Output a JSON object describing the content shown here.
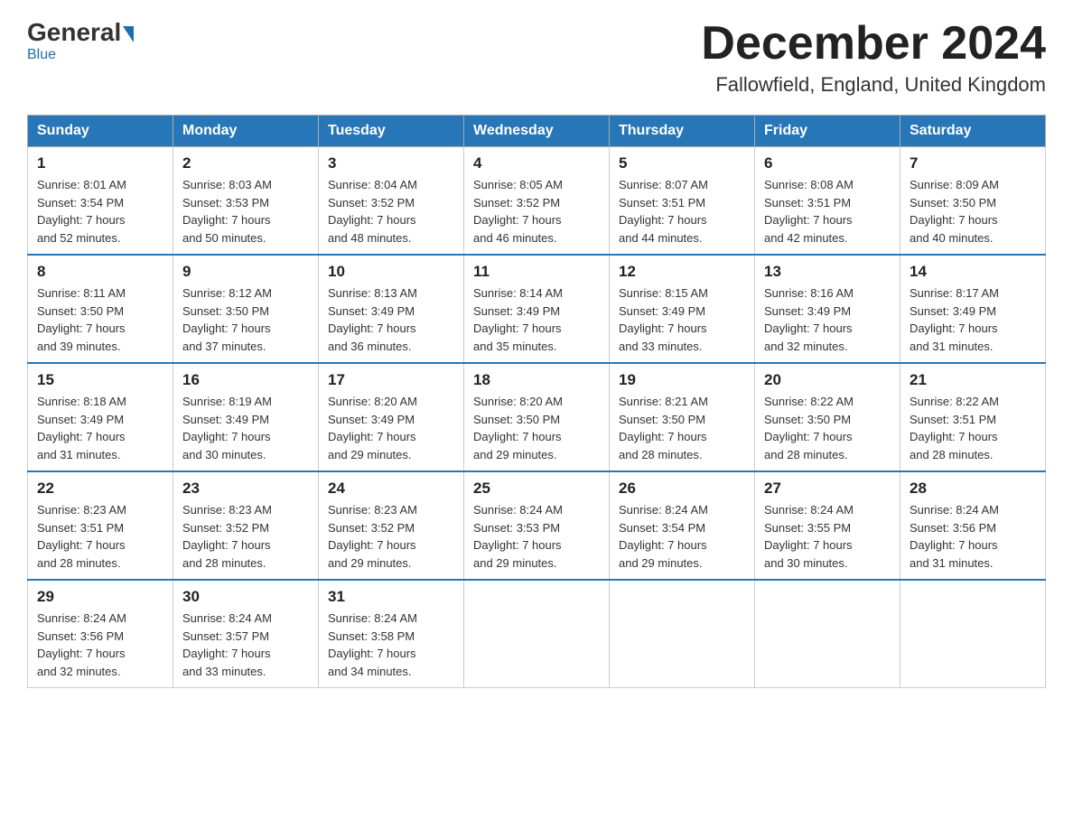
{
  "header": {
    "logo_general": "General",
    "logo_blue": "Blue",
    "month_title": "December 2024",
    "location": "Fallowfield, England, United Kingdom"
  },
  "days_of_week": [
    "Sunday",
    "Monday",
    "Tuesday",
    "Wednesday",
    "Thursday",
    "Friday",
    "Saturday"
  ],
  "weeks": [
    [
      {
        "day": "1",
        "sunrise": "8:01 AM",
        "sunset": "3:54 PM",
        "daylight": "7 hours and 52 minutes."
      },
      {
        "day": "2",
        "sunrise": "8:03 AM",
        "sunset": "3:53 PM",
        "daylight": "7 hours and 50 minutes."
      },
      {
        "day": "3",
        "sunrise": "8:04 AM",
        "sunset": "3:52 PM",
        "daylight": "7 hours and 48 minutes."
      },
      {
        "day": "4",
        "sunrise": "8:05 AM",
        "sunset": "3:52 PM",
        "daylight": "7 hours and 46 minutes."
      },
      {
        "day": "5",
        "sunrise": "8:07 AM",
        "sunset": "3:51 PM",
        "daylight": "7 hours and 44 minutes."
      },
      {
        "day": "6",
        "sunrise": "8:08 AM",
        "sunset": "3:51 PM",
        "daylight": "7 hours and 42 minutes."
      },
      {
        "day": "7",
        "sunrise": "8:09 AM",
        "sunset": "3:50 PM",
        "daylight": "7 hours and 40 minutes."
      }
    ],
    [
      {
        "day": "8",
        "sunrise": "8:11 AM",
        "sunset": "3:50 PM",
        "daylight": "7 hours and 39 minutes."
      },
      {
        "day": "9",
        "sunrise": "8:12 AM",
        "sunset": "3:50 PM",
        "daylight": "7 hours and 37 minutes."
      },
      {
        "day": "10",
        "sunrise": "8:13 AM",
        "sunset": "3:49 PM",
        "daylight": "7 hours and 36 minutes."
      },
      {
        "day": "11",
        "sunrise": "8:14 AM",
        "sunset": "3:49 PM",
        "daylight": "7 hours and 35 minutes."
      },
      {
        "day": "12",
        "sunrise": "8:15 AM",
        "sunset": "3:49 PM",
        "daylight": "7 hours and 33 minutes."
      },
      {
        "day": "13",
        "sunrise": "8:16 AM",
        "sunset": "3:49 PM",
        "daylight": "7 hours and 32 minutes."
      },
      {
        "day": "14",
        "sunrise": "8:17 AM",
        "sunset": "3:49 PM",
        "daylight": "7 hours and 31 minutes."
      }
    ],
    [
      {
        "day": "15",
        "sunrise": "8:18 AM",
        "sunset": "3:49 PM",
        "daylight": "7 hours and 31 minutes."
      },
      {
        "day": "16",
        "sunrise": "8:19 AM",
        "sunset": "3:49 PM",
        "daylight": "7 hours and 30 minutes."
      },
      {
        "day": "17",
        "sunrise": "8:20 AM",
        "sunset": "3:49 PM",
        "daylight": "7 hours and 29 minutes."
      },
      {
        "day": "18",
        "sunrise": "8:20 AM",
        "sunset": "3:50 PM",
        "daylight": "7 hours and 29 minutes."
      },
      {
        "day": "19",
        "sunrise": "8:21 AM",
        "sunset": "3:50 PM",
        "daylight": "7 hours and 28 minutes."
      },
      {
        "day": "20",
        "sunrise": "8:22 AM",
        "sunset": "3:50 PM",
        "daylight": "7 hours and 28 minutes."
      },
      {
        "day": "21",
        "sunrise": "8:22 AM",
        "sunset": "3:51 PM",
        "daylight": "7 hours and 28 minutes."
      }
    ],
    [
      {
        "day": "22",
        "sunrise": "8:23 AM",
        "sunset": "3:51 PM",
        "daylight": "7 hours and 28 minutes."
      },
      {
        "day": "23",
        "sunrise": "8:23 AM",
        "sunset": "3:52 PM",
        "daylight": "7 hours and 28 minutes."
      },
      {
        "day": "24",
        "sunrise": "8:23 AM",
        "sunset": "3:52 PM",
        "daylight": "7 hours and 29 minutes."
      },
      {
        "day": "25",
        "sunrise": "8:24 AM",
        "sunset": "3:53 PM",
        "daylight": "7 hours and 29 minutes."
      },
      {
        "day": "26",
        "sunrise": "8:24 AM",
        "sunset": "3:54 PM",
        "daylight": "7 hours and 29 minutes."
      },
      {
        "day": "27",
        "sunrise": "8:24 AM",
        "sunset": "3:55 PM",
        "daylight": "7 hours and 30 minutes."
      },
      {
        "day": "28",
        "sunrise": "8:24 AM",
        "sunset": "3:56 PM",
        "daylight": "7 hours and 31 minutes."
      }
    ],
    [
      {
        "day": "29",
        "sunrise": "8:24 AM",
        "sunset": "3:56 PM",
        "daylight": "7 hours and 32 minutes."
      },
      {
        "day": "30",
        "sunrise": "8:24 AM",
        "sunset": "3:57 PM",
        "daylight": "7 hours and 33 minutes."
      },
      {
        "day": "31",
        "sunrise": "8:24 AM",
        "sunset": "3:58 PM",
        "daylight": "7 hours and 34 minutes."
      },
      null,
      null,
      null,
      null
    ]
  ],
  "labels": {
    "sunrise": "Sunrise:",
    "sunset": "Sunset:",
    "daylight": "Daylight:"
  }
}
